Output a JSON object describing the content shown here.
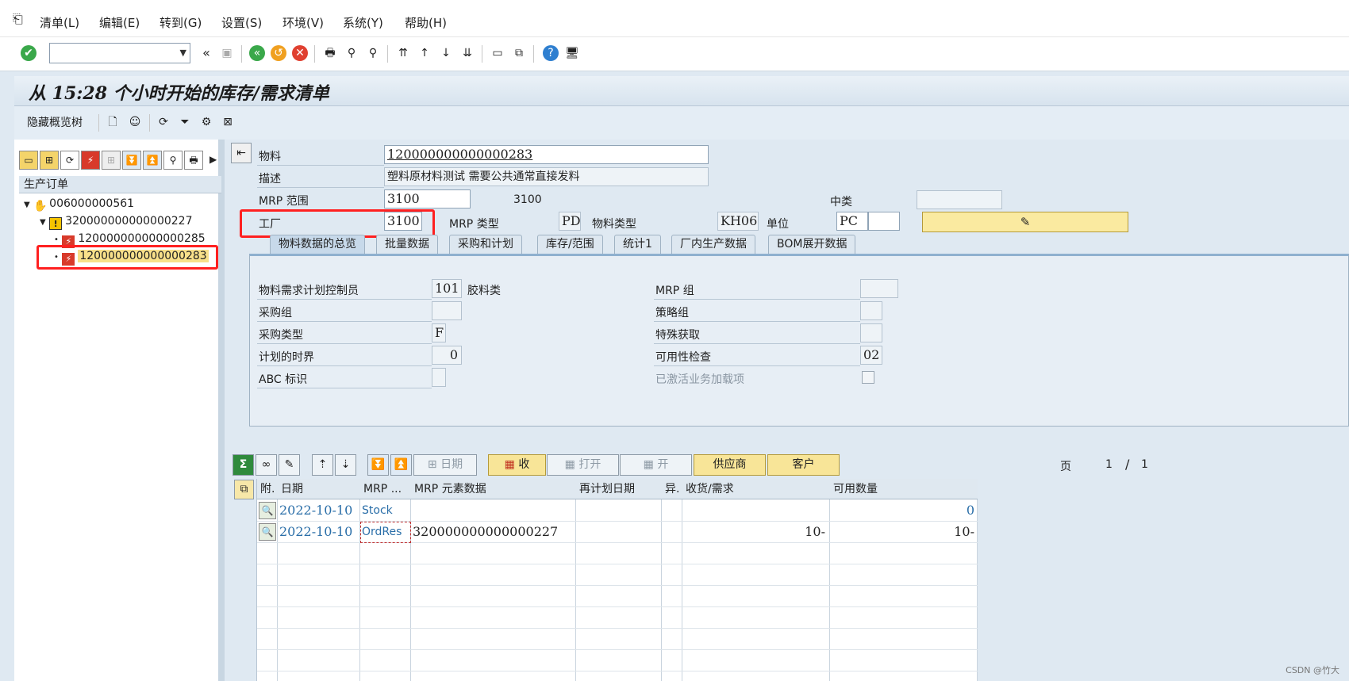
{
  "menu": [
    "清单(L)",
    "编辑(E)",
    "转到(G)",
    "设置(S)",
    "环境(V)",
    "系统(Y)",
    "帮助(H)"
  ],
  "title": "从 15:28 个小时开始的库存/需求清单",
  "app_toolbar": {
    "hide_tree": "隐藏概览树"
  },
  "tree": {
    "header": "生产订单",
    "nodes": [
      "006000000561",
      "320000000000000227",
      "120000000000000285",
      "120000000000000283"
    ]
  },
  "header": {
    "material_label": "物料",
    "material_value": "120000000000000283",
    "desc_label": "描述",
    "desc_value": "塑料原材料测试  需要公共通常直接发料",
    "mrp_area_label": "MRP 范围",
    "mrp_area_value": "3100",
    "mrp_area_text": "3100",
    "middle_class_label": "中类",
    "middle_class_value": "",
    "plant_label": "工厂",
    "plant_value": "3100",
    "mrp_type_label": "MRP 类型",
    "mrp_type_value": "PD",
    "material_type_label": "物料类型",
    "material_type_value": "KH06",
    "unit_label": "单位",
    "unit_value": "PC",
    "unit_extra": ""
  },
  "tabs": [
    "物料数据的总览",
    "批量数据",
    "采购和计划",
    "库存/范围",
    "统计1",
    "厂内生产数据",
    "BOM展开数据"
  ],
  "overview": {
    "mrp_controller_label": "物料需求计划控制员",
    "mrp_controller_value": "101",
    "mrp_controller_text": "胶料类",
    "purchasing_group_label": "采购组",
    "purchasing_group_value": "",
    "procurement_type_label": "采购类型",
    "procurement_type_value": "F",
    "planning_horizon_label": "计划的时界",
    "planning_horizon_value": "0",
    "abc_label": "ABC 标识",
    "abc_value": "",
    "mrp_group_label": "MRP 组",
    "mrp_group_value": "",
    "strategy_group_label": "策略组",
    "strategy_group_value": "",
    "special_procurement_label": "特殊获取",
    "special_procurement_value": "",
    "availability_check_label": "可用性检查",
    "availability_check_value": "02",
    "business_addon_label": "已激活业务加载项"
  },
  "list_toolbar": {
    "date_btn": "日期",
    "receipt_btn": "收",
    "open_btn": "打开",
    "open2_btn": "开",
    "vendor_btn": "供应商",
    "customer_btn": "客户",
    "page_label": "页",
    "page_current": "1",
    "page_sep": "/",
    "page_total": "1"
  },
  "grid": {
    "headers": [
      "附.",
      "日期",
      "MRP ...",
      "MRP 元素数据",
      "再计划日期",
      "异.",
      "收货/需求",
      "可用数量"
    ],
    "rows": [
      {
        "date": "2022-10-10",
        "mrp": "Stock",
        "element": "",
        "reschedule": "",
        "exception": "",
        "receipt": "",
        "available": "0"
      },
      {
        "date": "2022-10-10",
        "mrp": "OrdRes",
        "element": "320000000000000227",
        "reschedule": "",
        "exception": "",
        "receipt": "10-",
        "available": "10-"
      }
    ]
  },
  "watermark": "CSDN @竹大",
  "colors": {
    "accent_red": "#ff2020",
    "button_yellow": "#f8e598",
    "link_blue": "#2a6ea8"
  }
}
